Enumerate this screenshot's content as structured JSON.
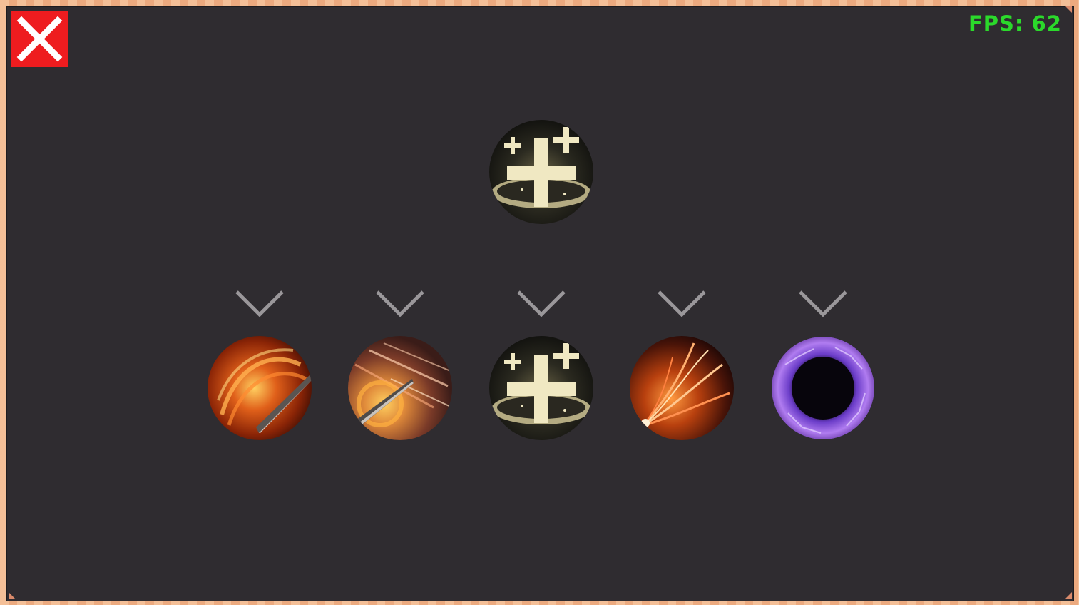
{
  "hud": {
    "fps_label": "FPS: 62"
  },
  "controls": {
    "close_icon": "close-icon"
  },
  "skill_tree": {
    "root": {
      "icon": "holy-cross-icon"
    },
    "branches": [
      {
        "icon": "flame-sword-slash-icon"
      },
      {
        "icon": "blade-dash-icon"
      },
      {
        "icon": "holy-cross-icon"
      },
      {
        "icon": "fire-burst-icon"
      },
      {
        "icon": "void-orb-icon"
      }
    ]
  },
  "colors": {
    "panel": "#2f2c30",
    "border": "#eeb088",
    "close_bg": "#ee1c1f",
    "fps_text": "#2bd92b",
    "chevron": "#9a979a"
  }
}
